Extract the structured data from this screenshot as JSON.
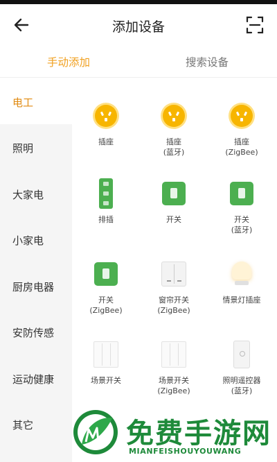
{
  "header": {
    "title": "添加设备",
    "back_icon": "arrow-left-icon",
    "scan_icon": "scan-icon"
  },
  "tabs": [
    {
      "label": "手动添加",
      "active": true
    },
    {
      "label": "搜索设备",
      "active": false
    }
  ],
  "sidebar": {
    "items": [
      {
        "label": "电工",
        "active": true
      },
      {
        "label": "照明",
        "active": false
      },
      {
        "label": "大家电",
        "active": false
      },
      {
        "label": "小家电",
        "active": false
      },
      {
        "label": "厨房电器",
        "active": false
      },
      {
        "label": "安防传感",
        "active": false
      },
      {
        "label": "运动健康",
        "active": false
      },
      {
        "label": "其它",
        "active": false
      }
    ]
  },
  "devices": [
    {
      "name": "插座",
      "sub": "",
      "icon": "plug-icon"
    },
    {
      "name": "插座",
      "sub": "(蓝牙)",
      "icon": "plug-icon"
    },
    {
      "name": "插座",
      "sub": "(ZigBee)",
      "icon": "plug-icon"
    },
    {
      "name": "排插",
      "sub": "",
      "icon": "power-strip-icon"
    },
    {
      "name": "开关",
      "sub": "",
      "icon": "switch-icon"
    },
    {
      "name": "开关",
      "sub": "(蓝牙)",
      "icon": "switch-icon"
    },
    {
      "name": "开关",
      "sub": "(ZigBee)",
      "icon": "switch-icon"
    },
    {
      "name": "窗帘开关",
      "sub": "(ZigBee)",
      "icon": "curtain-switch-icon"
    },
    {
      "name": "情景灯插座",
      "sub": "",
      "icon": "lamp-icon"
    },
    {
      "name": "场景开关",
      "sub": "",
      "icon": "scene-switch-icon"
    },
    {
      "name": "场景开关",
      "sub": "(ZigBee)",
      "icon": "scene-switch-icon"
    },
    {
      "name": "照明遥控器",
      "sub": "(蓝牙)",
      "icon": "remote-icon"
    }
  ],
  "watermark": {
    "title": "免费手游网",
    "subtitle": "MIANFEISHOUYOUWANG"
  },
  "colors": {
    "accent": "#f0a020",
    "sidebar_bg": "#f5f5f5",
    "device_green": "#4caf50",
    "plug_yellow": "#f7b500",
    "watermark_green": "#1e8a3a"
  }
}
